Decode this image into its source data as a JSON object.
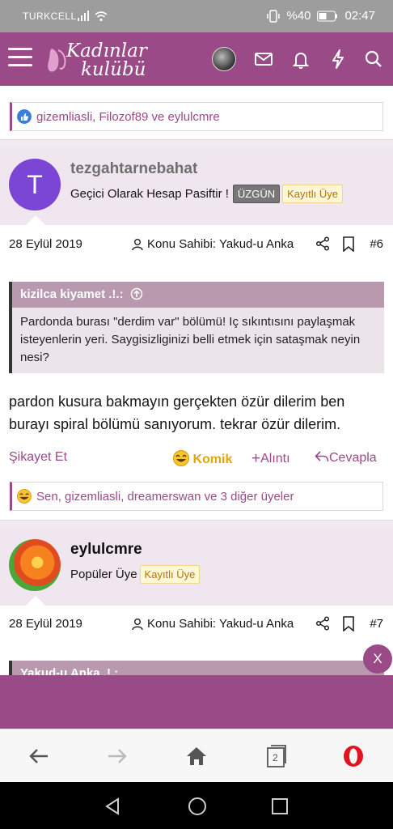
{
  "status_bar": {
    "carrier": "TURKCELL",
    "battery": "%40",
    "time": "02:47"
  },
  "header": {
    "logo_line1": "Kadınlar",
    "logo_line2": "kulübü",
    "icons": [
      "menu-icon",
      "avatar",
      "mail-icon",
      "bell-icon",
      "bolt-icon",
      "search-icon"
    ]
  },
  "top_reactions": {
    "text": "gizemliasli, Filozof89 ve eylulcmre",
    "emoji": "like-icon"
  },
  "post1": {
    "avatar_letter": "T",
    "username": "tezgahtarnebahat",
    "title": "Geçici Olarak Hesap Pasiftir !",
    "badge1": "ÜZGÜN",
    "badge2": "Kayıtlı Üye",
    "date": "28 Eylül 2019",
    "owner": "Konu Sahibi: Yakud-u Anka",
    "number": "#6",
    "quote_author": "kizilca kiyamet .!.:",
    "quote_text": "Pardonda burası \"derdim var\" bölümü! Iç sıkıntısını paylaşmak isteyenlerin yeri. Saygisizliginizi belli etmek için sataşmak neyin nesi?",
    "body": "pardon kusura bakmayın gerçekten özür dilerim ben burayı spiral bölümü sanıyorum. tekrar özür dilerim.",
    "report": "Şikayet Et",
    "reaction": "Komik",
    "quote_btn": "Alıntı",
    "reply_btn": "Cevapla",
    "reactions_text": "Sen, gizemliasli, dreamerswan ve 3 diğer üyeler"
  },
  "post2": {
    "username": "eylulcmre",
    "title": "Popüler Üye",
    "badge": "Kayıtlı Üye",
    "date": "28 Eylül 2019",
    "owner": "Konu Sahibi: Yakud-u Anka",
    "number": "#7",
    "quote_author": "Yakud-u Anka .!.:"
  },
  "close_float": "X",
  "browser": {
    "tabs_count": "2"
  },
  "colors": {
    "brand": "#9a4a87",
    "user_bg": "#f0e6ef"
  }
}
